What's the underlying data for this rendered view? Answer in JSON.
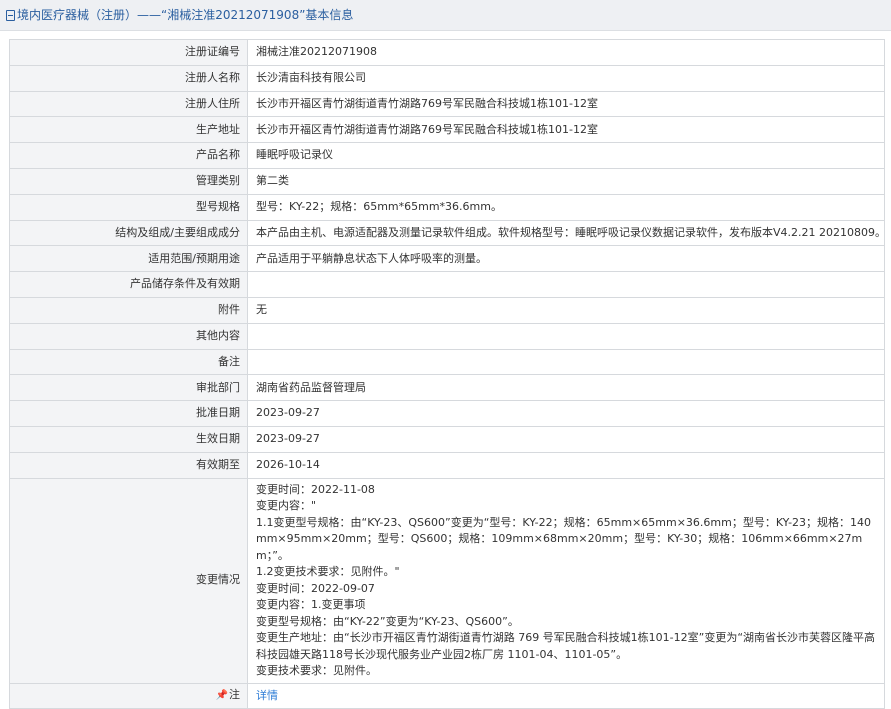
{
  "header": {
    "title": "境内医疗器械（注册）——“湘械注准20212071908”基本信息"
  },
  "fields": [
    {
      "label": "注册证编号",
      "value": "湘械注准20212071908"
    },
    {
      "label": "注册人名称",
      "value": "长沙清亩科技有限公司"
    },
    {
      "label": "注册人住所",
      "value": "长沙市开福区青竹湖街道青竹湖路769号军民融合科技城1栋101-12室"
    },
    {
      "label": "生产地址",
      "value": "长沙市开福区青竹湖街道青竹湖路769号军民融合科技城1栋101-12室"
    },
    {
      "label": "产品名称",
      "value": "睡眠呼吸记录仪"
    },
    {
      "label": "管理类别",
      "value": "第二类"
    },
    {
      "label": "型号规格",
      "value": "型号：KY-22；规格：65mm*65mm*36.6mm。"
    },
    {
      "label": "结构及组成/主要组成成分",
      "value": "本产品由主机、电源适配器及测量记录软件组成。软件规格型号：睡眠呼吸记录仪数据记录软件，发布版本V4.2.21 20210809。"
    },
    {
      "label": "适用范围/预期用途",
      "value": "产品适用于平躺静息状态下人体呼吸率的测量。"
    },
    {
      "label": "产品储存条件及有效期",
      "value": ""
    },
    {
      "label": "附件",
      "value": "无"
    },
    {
      "label": "其他内容",
      "value": ""
    },
    {
      "label": "备注",
      "value": ""
    },
    {
      "label": "审批部门",
      "value": "湖南省药品监督管理局"
    },
    {
      "label": "批准日期",
      "value": "2023-09-27"
    },
    {
      "label": "生效日期",
      "value": "2023-09-27"
    },
    {
      "label": "有效期至",
      "value": "2026-10-14"
    }
  ],
  "change": {
    "label": "变更情况",
    "lines": [
      "变更时间：2022-11-08",
      "变更内容：\"",
      "1.1变更型号规格：由“KY-23、QS600”变更为“型号：KY-22；规格：65mm×65mm×36.6mm；型号：KY-23；规格：140mm×95mm×20mm；型号：QS600；规格：109mm×68mm×20mm；型号：KY-30；规格：106mm×66mm×27mm；”。",
      "1.2变更技术要求：见附件。\"",
      "变更时间：2022-09-07",
      "变更内容：1.变更事项",
      "变更型号规格：由“KY-22”变更为“KY-23、QS600”。",
      "变更生产地址：由“长沙市开福区青竹湖街道青竹湖路 769 号军民融合科技城1栋101-12室”变更为“湖南省长沙市芙蓉区隆平高科技园雄天路118号长沙现代服务业产业园2栋厂房 1101-04、1101-05”。",
      "变更技术要求：见附件。"
    ]
  },
  "note": {
    "label": "注",
    "link": "详情"
  },
  "colors": {
    "label_bg": "#f3f4f6",
    "border": "#d6d9dd",
    "title_bg": "#eef0f3",
    "title_text": "#2b5fa0",
    "link": "#2b7bd6"
  }
}
